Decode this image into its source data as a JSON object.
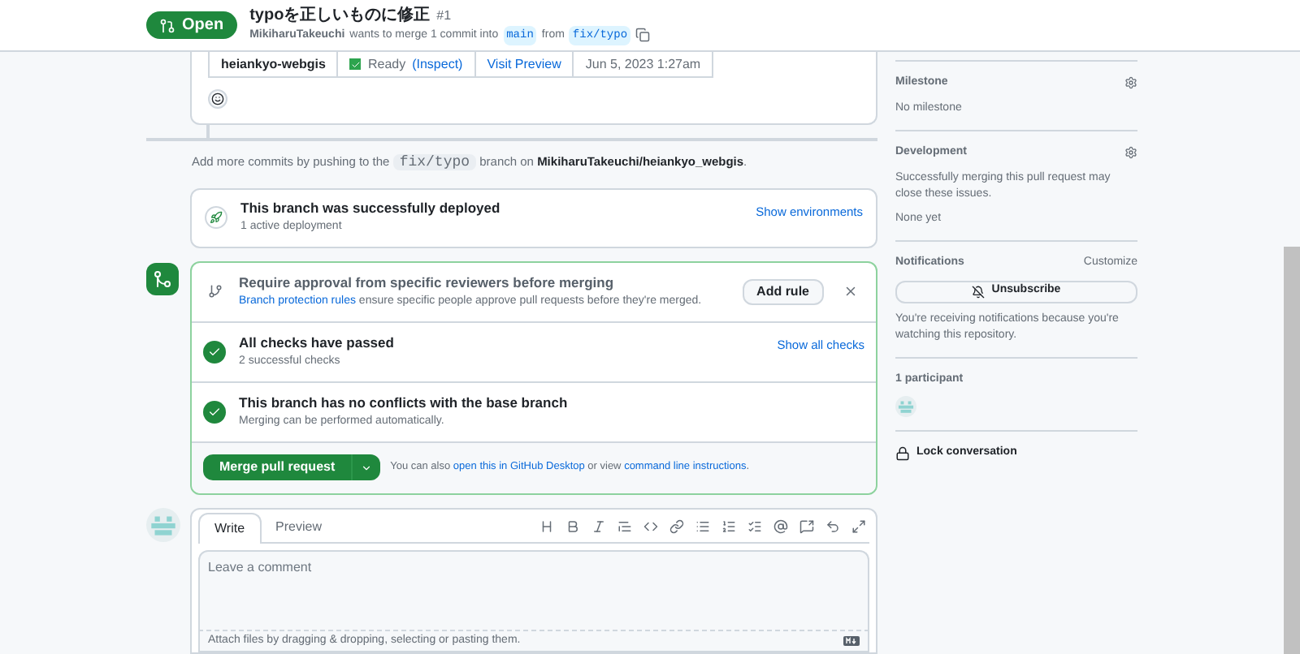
{
  "header": {
    "state": {
      "kind": "open",
      "label": "Open"
    },
    "title": "typoを正しいものに修正",
    "number": "#1",
    "author": "MikiharuTakeuchi",
    "merge_text": "wants to merge 1 commit into",
    "base_branch": "main",
    "from_text": "from",
    "head_branch": "fix/typo"
  },
  "deployment_table": {
    "environment": "heiankyo-webgis",
    "status": "Ready",
    "inspect_link": "(Inspect)",
    "preview_link": "Visit Preview",
    "updated": "Jun 5, 2023 1:27am"
  },
  "push_hint": [
    {
      "kind": "text",
      "text": "Add more commits by pushing to the "
    },
    {
      "kind": "code",
      "text": "fix/typo"
    },
    {
      "kind": "text",
      "text": " branch on "
    },
    {
      "kind": "bold",
      "text": "MikiharuTakeuchi/heiankyo_webgis"
    },
    {
      "kind": "text",
      "text": "."
    }
  ],
  "deployment": {
    "title": "This branch was successfully deployed",
    "subtitle": "1 active deployment",
    "action": "Show environments"
  },
  "merge_box": {
    "sections": [
      {
        "kind": "rule",
        "title": "Require approval from specific reviewers before merging",
        "link": "Branch protection rules",
        "description": " ensure specific people approve pull requests before they're merged.",
        "button": "Add rule"
      },
      {
        "kind": "check",
        "title": "All checks have passed",
        "subtitle": "2 successful checks",
        "action": "Show all checks"
      },
      {
        "kind": "check",
        "title": "This branch has no conflicts with the base branch",
        "subtitle": "Merging can be performed automatically."
      }
    ],
    "merge_button": "Merge pull request",
    "note": [
      {
        "kind": "text",
        "text": "You can also "
      },
      {
        "kind": "link",
        "text": "open this in GitHub Desktop"
      },
      {
        "kind": "text",
        "text": " or view "
      },
      {
        "kind": "link",
        "text": "command line instructions"
      },
      {
        "kind": "text",
        "text": "."
      }
    ]
  },
  "comment": {
    "tabs": [
      {
        "label": "Write",
        "selected": true
      },
      {
        "label": "Preview",
        "selected": false
      }
    ],
    "placeholder": "Leave a comment",
    "footer": "Attach files by dragging & dropping, selecting or pasting them."
  },
  "sidebar": {
    "milestone": {
      "heading": "Milestone",
      "value": "No milestone"
    },
    "development": {
      "heading": "Development",
      "description": "Successfully merging this pull request may close these issues.",
      "value": "None yet"
    },
    "notifications": {
      "heading": "Notifications",
      "action": "Customize",
      "button": "Unsubscribe",
      "description": "You're receiving notifications because you're watching this repository."
    },
    "participants": {
      "heading": "1 participant"
    },
    "lock": "Lock conversation"
  }
}
